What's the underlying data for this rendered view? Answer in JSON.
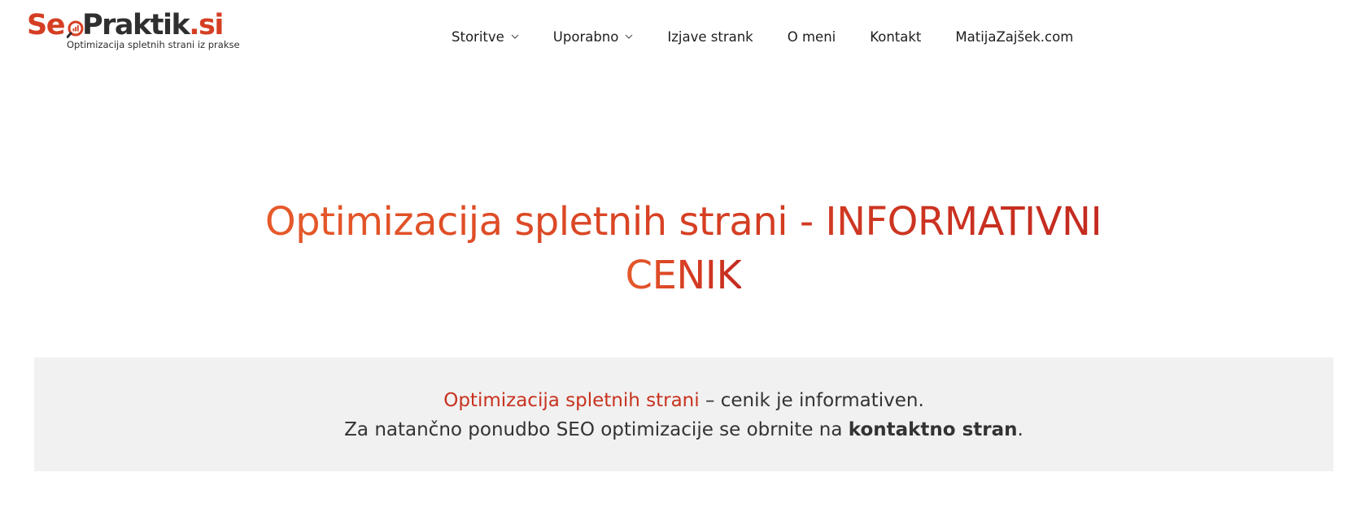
{
  "header": {
    "logo": {
      "part_seo": "Se",
      "part_praktik": "Praktik",
      "part_si": ".si",
      "tagline": "Optimizacija spletnih strani iz prakse",
      "brand_red": "#d53e23",
      "brand_dark": "#2f2f2f"
    },
    "nav": {
      "items": [
        {
          "label": "Storitve",
          "has_dropdown": true
        },
        {
          "label": "Uporabno",
          "has_dropdown": true
        },
        {
          "label": "Izjave strank",
          "has_dropdown": false
        },
        {
          "label": "O meni",
          "has_dropdown": false
        },
        {
          "label": "Kontakt",
          "has_dropdown": false
        },
        {
          "label": "MatijaZajšek.com",
          "has_dropdown": false
        }
      ]
    }
  },
  "hero": {
    "title_line1": "Optimizacija spletnih strani - INFORMATIVNI",
    "title_line2": "CENIK"
  },
  "info_box": {
    "link_text": "Optimizacija spletnih strani",
    "line1_rest": " – cenik je informativen.",
    "line2_prefix": "Za natančno ponudbo SEO optimizacije se obrnite na ",
    "line2_bold": "kontaktno stran",
    "line2_suffix": ".",
    "background": "#f1f1f1",
    "link_color": "#c8321f"
  }
}
